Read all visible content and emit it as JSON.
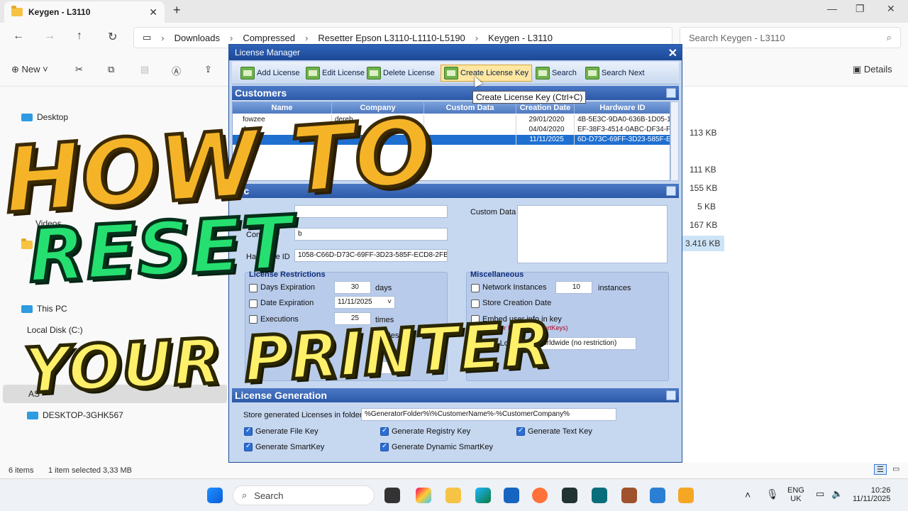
{
  "explorer": {
    "tab_title": "Keygen - L3110",
    "breadcrumb": [
      "Downloads",
      "Compressed",
      "Resetter Epson L3110-L1110-L5190",
      "Keygen - L3110"
    ],
    "search_placeholder": "Search Keygen - L3110",
    "toolbar": {
      "new_label": "New",
      "details_label": "Details"
    },
    "sidebar": {
      "desktop": "Desktop",
      "videos": "Videos",
      "re": "RE",
      "this_pc": "This PC",
      "local_disk": "Local Disk (C:)",
      "asus": "AS",
      "desktop_pc": "DESKTOP-3GHK567"
    },
    "sizes": [
      "113 KB",
      "111 KB",
      "155 KB",
      "5 KB",
      "167 KB",
      "3.416 KB"
    ],
    "status": {
      "items": "6 items",
      "selected": "1 item selected  3,33 MB"
    }
  },
  "license_manager": {
    "title": "License Manager",
    "toolbar": {
      "add": "Add License",
      "edit": "Edit License",
      "delete": "Delete License",
      "create": "Create License Key",
      "search": "Search",
      "search_next": "Search Next"
    },
    "tooltip": "Create License Key (Ctrl+C)",
    "customers_title": "Customers",
    "columns": [
      "Name",
      "Company",
      "Custom Data",
      "Creation Date",
      "Hardware ID"
    ],
    "rows": [
      {
        "name": "fowzee",
        "company": "dereh",
        "custom": "",
        "date": "29/01/2020",
        "hwid": "4B-5E3C-9DA0-636B-1D05-12"
      },
      {
        "name": "A",
        "company": "",
        "custom": "",
        "date": "04/04/2020",
        "hwid": "EF-38F3-4514-0ABC-DF34-F9"
      },
      {
        "name": "b",
        "company": "",
        "custom": "",
        "date": "11/11/2025",
        "hwid": "6D-D73C-69FF-3D23-585F-EC"
      }
    ],
    "license_section_title": "Lic",
    "fields": {
      "company_label": "Company",
      "company_value": "b",
      "hwid_label": "Hardware ID",
      "hwid_value": "1058-C66D-D73C-69FF-3D23-585F-ECD8-2FBD",
      "custom_label": "Custom Data"
    },
    "restrictions": {
      "title": "License Restrictions",
      "days_label": "Days Expiration",
      "days_value": "30",
      "days_unit": "days",
      "date_label": "Date Expiration",
      "date_value": "11/11/2025",
      "exec_label": "Executions",
      "exec_value": "25",
      "exec_unit": "times",
      "minutes1": "inutes",
      "minutes2": "inutes"
    },
    "misc": {
      "title": "Miscellaneous",
      "network_label": "Network Instances",
      "network_value": "10",
      "network_unit": "instances",
      "store_date_label": "Store Creation Date",
      "embed_label": "Embed user info in key",
      "embed_note": "(only for Dynamic SmartKeys)",
      "country_label": "Country Locking",
      "country_value": "- Worldwide (no restriction)"
    },
    "generation": {
      "title": "License Generation",
      "folder_label": "Store generated Licenses in folder:",
      "folder_value": "%GeneratorFolder%\\%CustomerName%-%CustomerCompany%",
      "file_key": "Generate File Key",
      "registry_key": "Generate Registry Key",
      "text_key": "Generate Text Key",
      "smartkey": "Generate SmartKey",
      "dynamic_smartkey": "Generate Dynamic SmartKey"
    }
  },
  "overlay": {
    "line1": "HOW TO",
    "line2": "RESET",
    "line3": "YOUR PRINTER"
  },
  "taskbar": {
    "search_label": "Search",
    "lang": "ENG",
    "region": "UK",
    "time": "10:26",
    "date": "11/11/2025"
  }
}
